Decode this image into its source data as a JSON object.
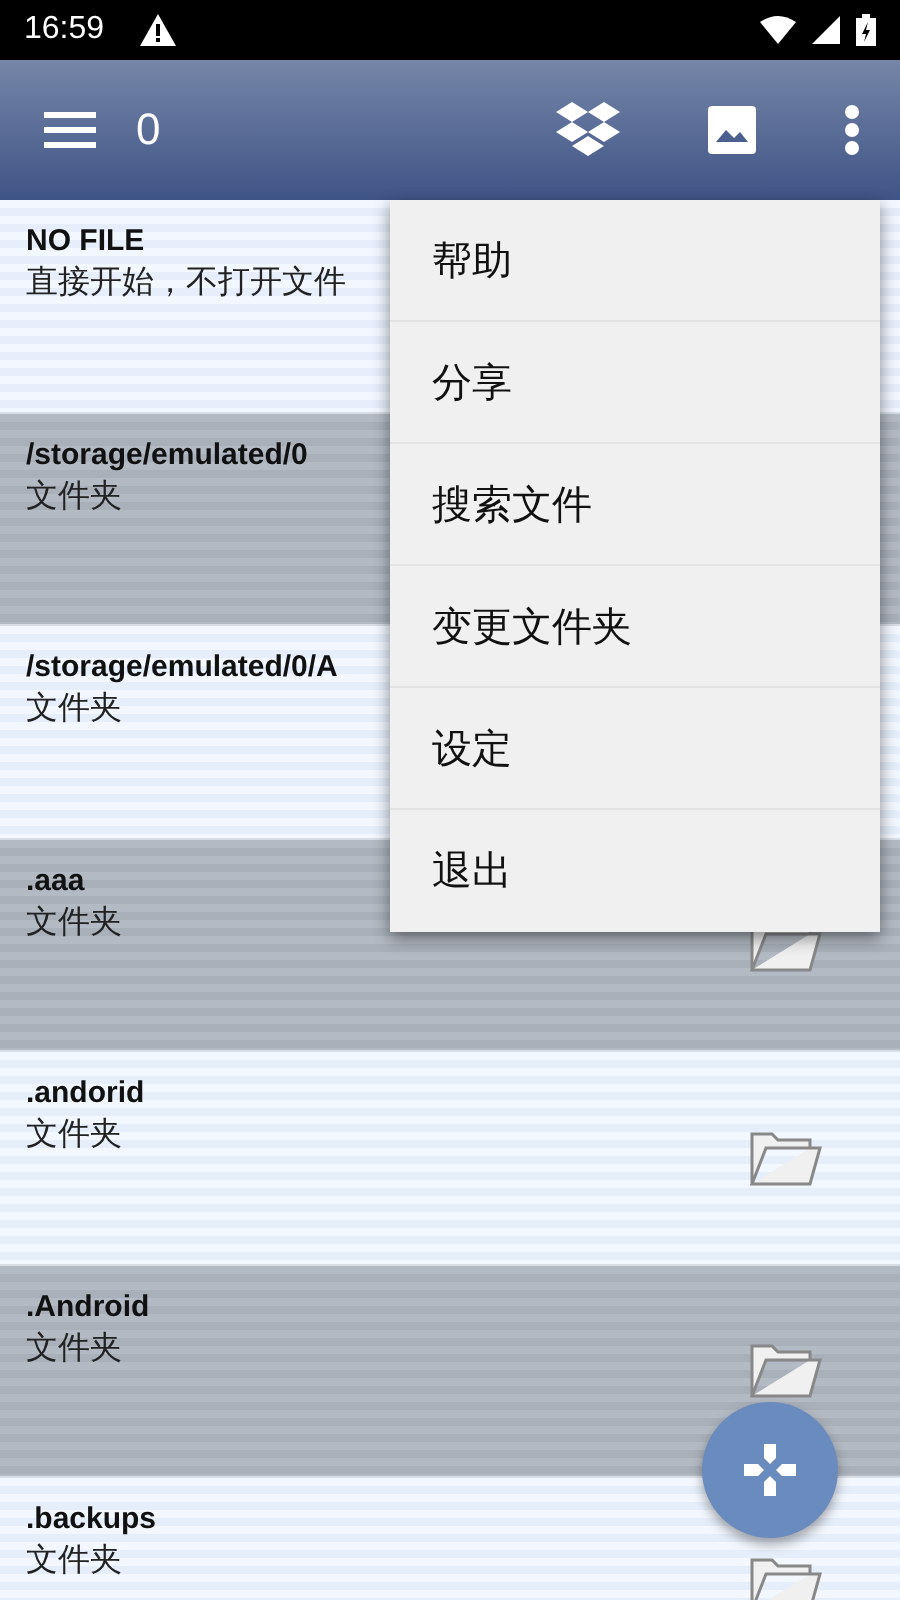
{
  "status_bar": {
    "time": "16:59"
  },
  "toolbar": {
    "count": "0"
  },
  "files": [
    {
      "name": "NO FILE",
      "detail": "直接开始，不打开文件",
      "alt": false
    },
    {
      "name": "/storage/emulated/0",
      "detail": "文件夹",
      "alt": true
    },
    {
      "name": "/storage/emulated/0/A",
      "detail": "文件夹",
      "alt": false
    },
    {
      "name": ".aaa",
      "detail": "文件夹",
      "alt": true,
      "folder_icon": true
    },
    {
      "name": ".andorid",
      "detail": "文件夹",
      "alt": false,
      "folder_icon": true
    },
    {
      "name": ".Android",
      "detail": "文件夹",
      "alt": true,
      "folder_icon": true
    },
    {
      "name": ".backups",
      "detail": "文件夹",
      "alt": false,
      "folder_icon": true
    }
  ],
  "menu": {
    "items": [
      "帮助",
      "分享",
      "搜索文件",
      "变更文件夹",
      "设定",
      "退出"
    ]
  }
}
